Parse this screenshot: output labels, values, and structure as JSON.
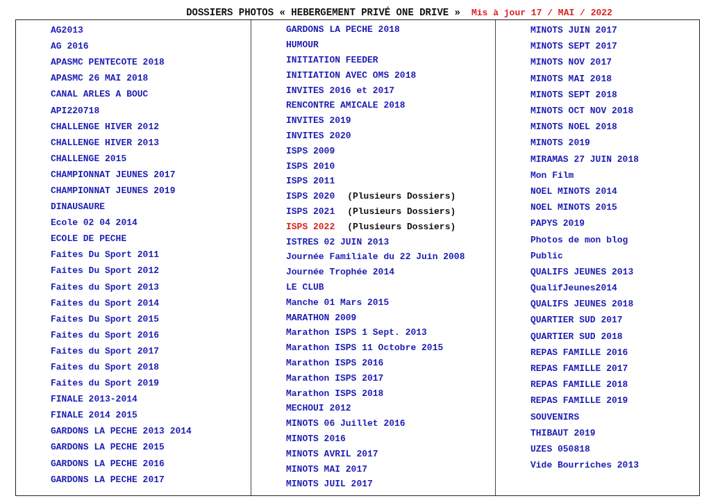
{
  "header": {
    "title": "DOSSIERS PHOTOS « HEBERGEMENT PRIVÉ ONE DRIVE »",
    "updated": "Mis à jour 17 / MAI / 2022"
  },
  "columns": [
    [
      {
        "label": "AG2013",
        "color": "#1c1cb4"
      },
      {
        "label": "AG 2016",
        "color": "#1c1cb4"
      },
      {
        "label": "APASMC PENTECOTE 2018",
        "color": "#1c1cb4"
      },
      {
        "label": "APASMC 26 MAI 2018",
        "color": "#1c1cb4"
      },
      {
        "label": "CANAL ARLES A BOUC",
        "color": "#1c1cb4"
      },
      {
        "label": "API220718",
        "color": "#1c1cb4"
      },
      {
        "label": "CHALLENGE HIVER 2012",
        "color": "#1c1cb4"
      },
      {
        "label": "CHALLENGE HIVER 2013",
        "color": "#1c1cb4"
      },
      {
        "label": "CHALLENGE 2015",
        "color": "#1c1cb4"
      },
      {
        "label": "CHAMPIONNAT JEUNES 2017",
        "color": "#1c1cb4"
      },
      {
        "label": "CHAMPIONNAT JEUNES 2019",
        "color": "#1c1cb4"
      },
      {
        "label": "DINAUSAURE",
        "color": "#1c1cb4"
      },
      {
        "label": "Ecole 02 04 2014",
        "color": "#1c1cb4"
      },
      {
        "label": "ECOLE DE PECHE",
        "color": "#1c1cb4"
      },
      {
        "label": "Faites Du Sport 2011",
        "color": "#1c1cb4"
      },
      {
        "label": "Faites Du Sport 2012",
        "color": "#1c1cb4"
      },
      {
        "label": "Faites du Sport 2013",
        "color": "#1c1cb4"
      },
      {
        "label": "Faites du Sport 2014",
        "color": "#1c1cb4"
      },
      {
        "label": "Faites Du Sport 2015",
        "color": "#1c1cb4"
      },
      {
        "label": "Faites du Sport 2016",
        "color": "#1c1cb4"
      },
      {
        "label": "Faites du Sport 2017",
        "color": "#1c1cb4"
      },
      {
        "label": "Faites du Sport 2018",
        "color": "#1c1cb4"
      },
      {
        "label": "Faites du Sport 2019",
        "color": "#1c1cb4"
      },
      {
        "label": "FINALE 2013-2014",
        "color": "#1c1cb4"
      },
      {
        "label": "FINALE 2014 2015",
        "color": "#1c1cb4"
      },
      {
        "label": "GARDONS LA PECHE 2013 2014",
        "color": "#1c1cb4"
      },
      {
        "label": "GARDONS LA PECHE 2015",
        "color": "#1c1cb4"
      },
      {
        "label": "GARDONS LA PECHE 2016",
        "color": "#1c1cb4"
      },
      {
        "label": "GARDONS LA PECHE 2017",
        "color": "#1c1cb4"
      }
    ],
    [
      {
        "label": "GARDONS LA PECHE 2018",
        "color": "#1c1cb4"
      },
      {
        "label": "HUMOUR",
        "color": "#1c1cb4"
      },
      {
        "label": "INITIATION FEEDER",
        "color": "#1c1cb4"
      },
      {
        "label": "INITIATION AVEC OMS 2018",
        "color": "#1c1cb4"
      },
      {
        "label": "INVITES 2016 et 2017",
        "color": "#1c1cb4"
      },
      {
        "label": "RENCONTRE AMICALE 2018",
        "color": "#1c1cb4"
      },
      {
        "label": "INVITES 2019",
        "color": "#1c1cb4"
      },
      {
        "label": "INVITES 2020",
        "color": "#1c1cb4"
      },
      {
        "label": "ISPS 2009",
        "color": "#1c1cb4"
      },
      {
        "label": "ISPS 2010",
        "color": "#1c1cb4"
      },
      {
        "label": "ISPS 2011",
        "color": "#1c1cb4"
      },
      {
        "label": "ISPS 2020",
        "color": "#1c1cb4",
        "note": "(Plusieurs Dossiers)"
      },
      {
        "label": "ISPS 2021",
        "color": "#1c1cb4",
        "note": "(Plusieurs Dossiers)"
      },
      {
        "label": "ISPS 2022",
        "color": "#dd2222",
        "note": "(Plusieurs Dossiers)"
      },
      {
        "label": "ISTRES 02 JUIN 2013",
        "color": "#1c1cb4"
      },
      {
        "label": "Journée Familiale du 22 Juin 2008",
        "color": "#1c1cb4"
      },
      {
        "label": "Journée Trophée 2014",
        "color": "#1c1cb4"
      },
      {
        "label": "LE CLUB",
        "color": "#1c1cb4"
      },
      {
        "label": "Manche 01 Mars 2015",
        "color": "#1c1cb4"
      },
      {
        "label": "MARATHON 2009",
        "color": "#1c1cb4"
      },
      {
        "label": "Marathon ISPS 1 Sept. 2013",
        "color": "#1c1cb4"
      },
      {
        "label": "Marathon ISPS 11 Octobre 2015",
        "color": "#1c1cb4"
      },
      {
        "label": "Marathon ISPS 2016",
        "color": "#1c1cb4"
      },
      {
        "label": "Marathon ISPS 2017",
        "color": "#1c1cb4"
      },
      {
        "label": "Marathon ISPS 2018",
        "color": "#1c1cb4"
      },
      {
        "label": "MECHOUI 2012",
        "color": "#1c1cb4"
      },
      {
        "label": "MINOTS 06 Juillet 2016",
        "color": "#1c1cb4"
      },
      {
        "label": "MINOTS 2016",
        "color": "#1c1cb4"
      },
      {
        "label": "MINOTS AVRIL 2017",
        "color": "#1c1cb4"
      },
      {
        "label": "MINOTS MAI 2017",
        "color": "#1c1cb4"
      },
      {
        "label": "MINOTS JUIL 2017",
        "color": "#1c1cb4"
      }
    ],
    [
      {
        "label": "MINOTS JUIN 2017",
        "color": "#1c1cb4"
      },
      {
        "label": "MINOTS SEPT 2017",
        "color": "#1c1cb4"
      },
      {
        "label": "MINOTS NOV 2017",
        "color": "#1c1cb4"
      },
      {
        "label": "MINOTS MAI 2018",
        "color": "#1c1cb4"
      },
      {
        "label": "MINOTS SEPT 2018",
        "color": "#1c1cb4"
      },
      {
        "label": "MINOTS OCT NOV 2018",
        "color": "#1c1cb4"
      },
      {
        "label": "MINOTS NOEL 2018",
        "color": "#1c1cb4"
      },
      {
        "label": "MINOTS 2019",
        "color": "#1c1cb4"
      },
      {
        "label": "MIRAMAS 27 JUIN 2018",
        "color": "#1c1cb4"
      },
      {
        "label": "Mon Film",
        "color": "#1c1cb4"
      },
      {
        "label": "NOEL MINOTS 2014",
        "color": "#1c1cb4"
      },
      {
        "label": "NOEL MINOTS 2015",
        "color": "#1c1cb4"
      },
      {
        "label": "PAPYS 2019",
        "color": "#1c1cb4"
      },
      {
        "label": "Photos de mon blog",
        "color": "#1c1cb4"
      },
      {
        "label": "Public",
        "color": "#1c1cb4"
      },
      {
        "label": "QUALIFS JEUNES 2013",
        "color": "#1c1cb4"
      },
      {
        "label": "QualifJeunes2014",
        "color": "#1c1cb4"
      },
      {
        "label": "QUALIFS JEUNES 2018",
        "color": "#1c1cb4"
      },
      {
        "label": "QUARTIER SUD 2017",
        "color": "#1c1cb4"
      },
      {
        "label": "QUARTIER SUD 2018",
        "color": "#1c1cb4"
      },
      {
        "label": "REPAS FAMILLE 2016",
        "color": "#1c1cb4"
      },
      {
        "label": "REPAS FAMILLE 2017",
        "color": "#1c1cb4"
      },
      {
        "label": "REPAS FAMILLE 2018",
        "color": "#1c1cb4"
      },
      {
        "label": "REPAS FAMILLE 2019",
        "color": "#1c1cb4"
      },
      {
        "label": "SOUVENIRS",
        "color": "#1c1cb4"
      },
      {
        "label": "THIBAUT 2019",
        "color": "#1c1cb4"
      },
      {
        "label": "UZES 050818",
        "color": "#1c1cb4"
      },
      {
        "label": "Vide Bourriches 2013",
        "color": "#1c1cb4"
      }
    ]
  ]
}
